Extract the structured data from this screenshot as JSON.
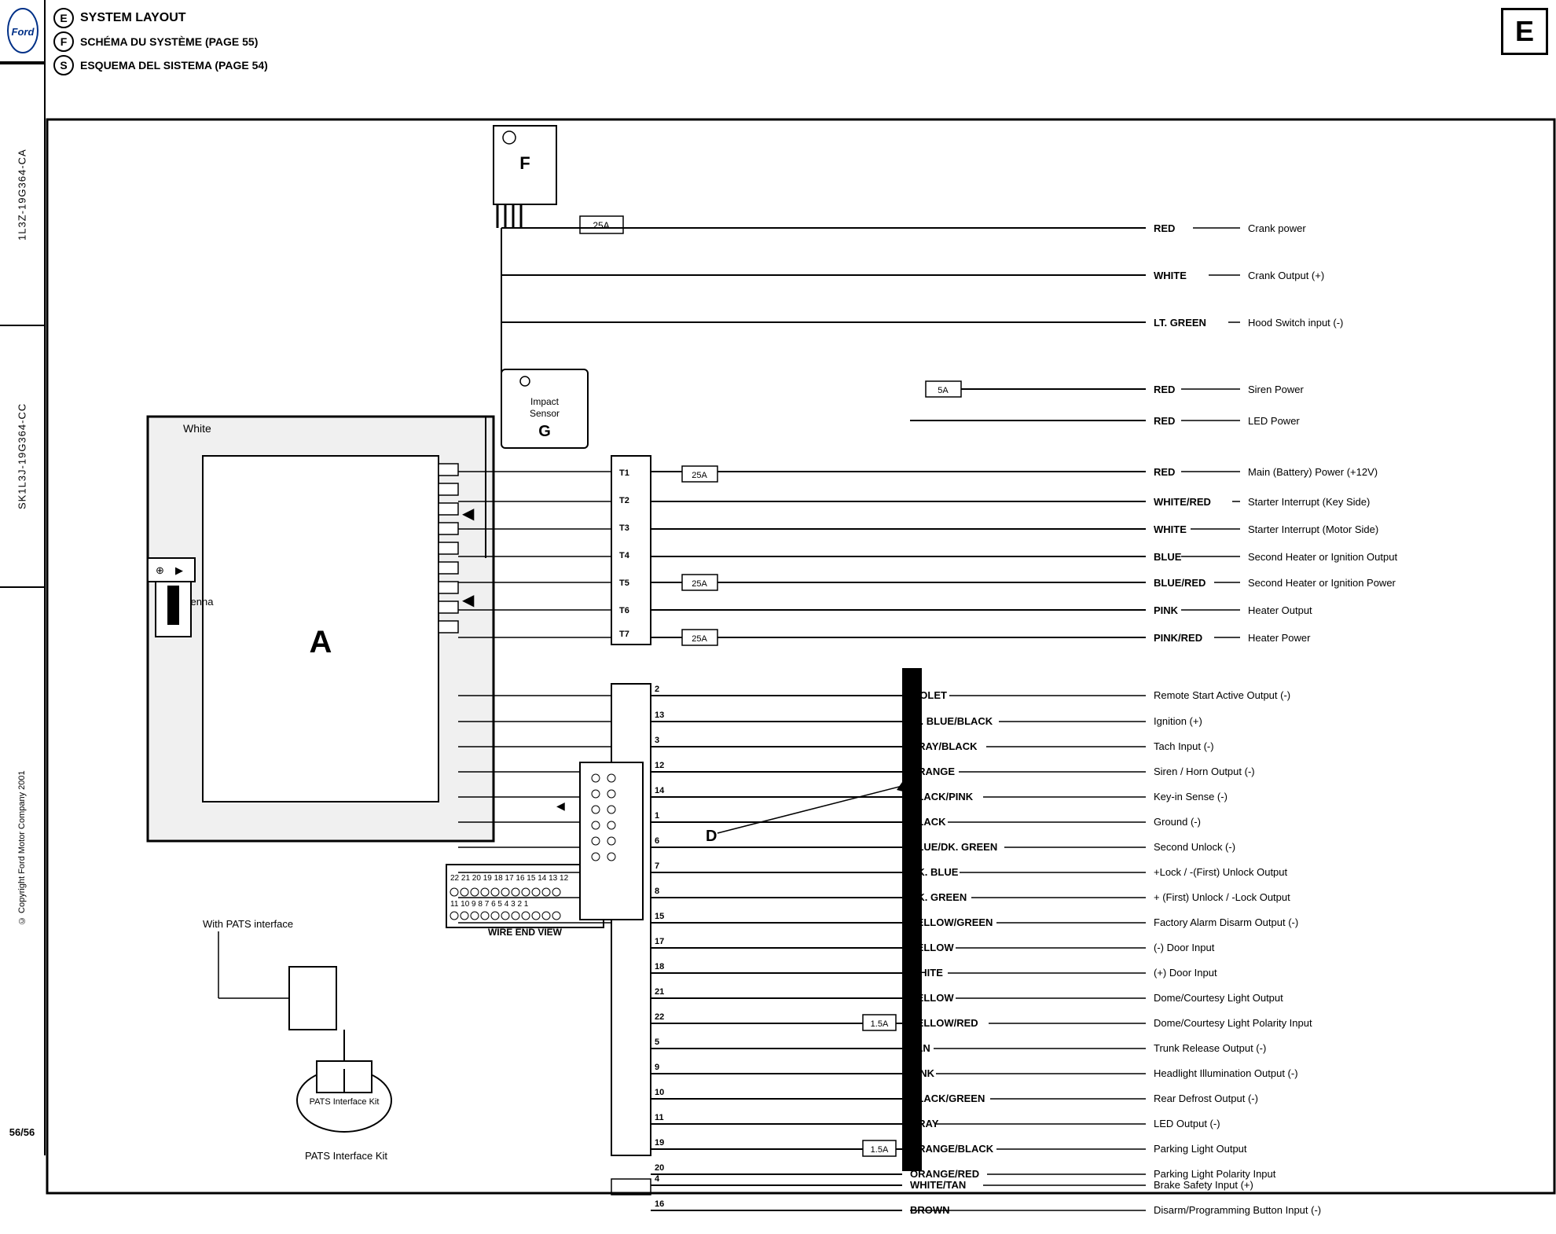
{
  "sidebar": {
    "logo_text": "Ford",
    "code1": "1L3Z-19G364-CA",
    "code2": "SK1L3J-19G364-CC",
    "copyright": "© Copyright Ford Motor Company 2001",
    "page": "56/56"
  },
  "header": {
    "lines": [
      {
        "circle": "E",
        "text": "SYSTEM LAYOUT"
      },
      {
        "circle": "F",
        "text": "SCHÉMA DU SYSTÈME (PAGE 55)"
      },
      {
        "circle": "S",
        "text": "ESQUEMA DEL SISTEMA (PAGE 54)"
      }
    ]
  },
  "badge": "E",
  "connectors": {
    "A": "A",
    "D": "D",
    "F": "F",
    "G": "G"
  },
  "labels": {
    "white": "White",
    "antenna": "Antenna",
    "with_pats": "With PATS interface",
    "pats_kit": "PATS Interface Kit",
    "wire_end_view": "WIRE END VIEW",
    "impact_sensor": "Impact\nSensor"
  },
  "wires_top": [
    {
      "color": "RED",
      "desc": "Crank power"
    },
    {
      "color": "WHITE",
      "desc": "Crank Output (+)"
    },
    {
      "color": "LT. GREEN",
      "desc": "Hood Switch input (-)"
    }
  ],
  "wires_siren": [
    {
      "color": "RED",
      "desc": "Siren Power",
      "fuse": "5A"
    },
    {
      "color": "RED",
      "desc": "LED Power"
    }
  ],
  "wires_main": [
    {
      "pin": "T1",
      "color": "RED",
      "desc": "Main (Battery) Power (+12V)",
      "fuse": "25A"
    },
    {
      "pin": "T2",
      "color": "WHITE/RED",
      "desc": "Starter Interrupt (Key Side)"
    },
    {
      "pin": "T3",
      "color": "WHITE",
      "desc": "Starter Interrupt (Motor Side)"
    },
    {
      "pin": "T4",
      "color": "BLUE",
      "desc": "Second Heater or Ignition Output"
    },
    {
      "pin": "T5",
      "color": "BLUE/RED",
      "desc": "Second Heater or Ignition Power",
      "fuse": "25A"
    },
    {
      "pin": "T6",
      "color": "PINK",
      "desc": "Heater Output"
    },
    {
      "pin": "T7",
      "color": "PINK/RED",
      "desc": "Heater Power",
      "fuse": "25A"
    }
  ],
  "wires_connector": [
    {
      "pin": "2",
      "color": "VIOLET",
      "desc": "Remote Start Active Output (-)"
    },
    {
      "pin": "13",
      "color": "LT. BLUE/BLACK",
      "desc": "Ignition (+)"
    },
    {
      "pin": "3",
      "color": "GRAY/BLACK",
      "desc": "Tach Input (-)"
    },
    {
      "pin": "12",
      "color": "ORANGE",
      "desc": "Siren / Horn Output (-)"
    },
    {
      "pin": "14",
      "color": "BLACK/PINK",
      "desc": "Key-in Sense (-)"
    },
    {
      "pin": "1",
      "color": "BLACK",
      "desc": "Ground (-)"
    },
    {
      "pin": "6",
      "color": "BLUE/DK. GREEN",
      "desc": "Second Unlock (-)"
    },
    {
      "pin": "7",
      "color": "DK. BLUE",
      "desc": "+Lock / -(First) Unlock Output"
    },
    {
      "pin": "8",
      "color": "DK. GREEN",
      "desc": "+ (First) Unlock / -Lock Output"
    },
    {
      "pin": "15",
      "color": "YELLOW/GREEN",
      "desc": "Factory Alarm Disarm Output (-)"
    },
    {
      "pin": "17",
      "color": "YELLOW",
      "desc": "(-) Door Input"
    },
    {
      "pin": "18",
      "color": "WHITE",
      "desc": "(+) Door Input"
    },
    {
      "pin": "21",
      "color": "YELLOW",
      "desc": "Dome/Courtesy Light Output"
    },
    {
      "pin": "22",
      "color": "YELLOW/RED",
      "desc": "Dome/Courtesy Light Polarity Input",
      "fuse": "1.5A"
    },
    {
      "pin": "5",
      "color": "TAN",
      "desc": "Trunk Release Output (-)"
    },
    {
      "pin": "9",
      "color": "PINK",
      "desc": "Headlight Illumination Output (-)"
    },
    {
      "pin": "10",
      "color": "BLACK/GREEN",
      "desc": "Rear Defrost Output (-)"
    },
    {
      "pin": "11",
      "color": "GRAY",
      "desc": "LED Output (-)"
    },
    {
      "pin": "19",
      "color": "ORANGE/BLACK",
      "desc": "Parking Light Output",
      "fuse": "1.5A"
    },
    {
      "pin": "20",
      "color": "ORANGE/RED",
      "desc": "Parking Light Polarity Input"
    },
    {
      "pin": "4",
      "color": "WHITE/TAN",
      "desc": "Brake Safety Input (+)"
    },
    {
      "pin": "16",
      "color": "BROWN",
      "desc": "Disarm/Programming Button Input (-)"
    }
  ],
  "wire_end_numbers_row1": [
    22,
    21,
    20,
    19,
    18,
    17,
    16,
    15,
    14,
    13,
    12
  ],
  "wire_end_numbers_row2": [
    11,
    10,
    9,
    8,
    7,
    6,
    5,
    4,
    3,
    2,
    1
  ]
}
